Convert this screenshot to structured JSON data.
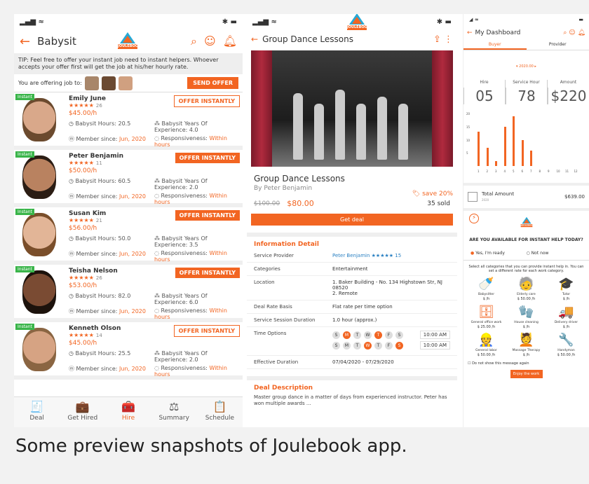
{
  "caption": "Some preview snapshots of Joulebook app.",
  "logo_text": "JOULEBOOK",
  "p1": {
    "title": "Babysit",
    "tip": "TIP: Feel free to offer your instant job need to instant helpers. Whoever accepts your offer first will get the job at his/her hourly rate.",
    "offering_label": "You are offering job to:",
    "send_offer": "SEND OFFER",
    "badge": "Instant",
    "hours_label": "Babysit Hours:",
    "years_label": "Babysit Years Of Experience:",
    "member_label": "Member since:",
    "resp_label": "Responsiveness:",
    "helpers": [
      {
        "name": "Emily June",
        "stars": "★★★★★",
        "count": "26",
        "rate": "$45.00/h",
        "hours": "20.5",
        "years": "4.0",
        "since": "Jun, 2020",
        "resp": "Within hours",
        "offer": "OFFER INSTANTLY",
        "filled": false,
        "skin": "#d9a88a",
        "hair": "#6b4a2e"
      },
      {
        "name": "Peter Benjamin",
        "stars": "★★★★★",
        "count": "11",
        "rate": "$50.00/h",
        "hours": "60.5",
        "years": "2.0",
        "since": "Jun, 2020",
        "resp": "Within hours",
        "offer": "OFFER INSTANTLY",
        "filled": true,
        "skin": "#b98260",
        "hair": "#2b1d14"
      },
      {
        "name": "Susan Kim",
        "stars": "★★★★★",
        "count": "21",
        "rate": "$56.00/h",
        "hours": "50.0",
        "years": "3.5",
        "since": "Jun, 2020",
        "resp": "Within hours",
        "offer": "OFFER INSTANTLY",
        "filled": true,
        "skin": "#e2b597",
        "hair": "#7a4e2a"
      },
      {
        "name": "Teisha Nelson",
        "stars": "★★★★★",
        "count": "26",
        "rate": "$53.00/h",
        "hours": "82.0",
        "years": "6.0",
        "since": "Jun, 2020",
        "resp": "Within hours",
        "offer": "OFFER INSTANTLY",
        "filled": true,
        "skin": "#7a4b33",
        "hair": "#1c120c"
      },
      {
        "name": "Kenneth Olson",
        "stars": "★★★★★",
        "count": "14",
        "rate": "$45.00/h",
        "hours": "25.5",
        "years": "2.0",
        "since": "Jun, 2020",
        "resp": "Within hours",
        "offer": "OFFER INSTANTLY",
        "filled": false,
        "skin": "#d6a383",
        "hair": "#8a6542"
      }
    ],
    "nav": [
      {
        "label": "Deal",
        "icon": "🧾"
      },
      {
        "label": "Get Hired",
        "icon": "💼"
      },
      {
        "label": "Hire",
        "icon": "🧰",
        "active": true
      },
      {
        "label": "Summary",
        "icon": "⚖"
      },
      {
        "label": "Schedule",
        "icon": "📋"
      }
    ]
  },
  "p2": {
    "title": "Group Dance Lessons",
    "product": "Group Dance Lessons",
    "save": "save 20%",
    "by": "By Peter Benjamin",
    "old_price": "$100.00",
    "price": "$80.00",
    "sold": "35 sold",
    "get_deal": "Get deal",
    "info_title": "Information Detail",
    "rows": [
      {
        "k": "Service Provider",
        "v": "Peter Benjamin ★★★★★ 15"
      },
      {
        "k": "Categories",
        "v": "Entertainment"
      },
      {
        "k": "Location",
        "v": "1. Baker Building - No. 134 Highstown Str, NJ 08520\n2. Remote"
      },
      {
        "k": "Deal Rate Basis",
        "v": "Flat rate per time option"
      },
      {
        "k": "Service Session Duration",
        "v": "1.0 hour (approx.)"
      }
    ],
    "time_label": "Time Options",
    "week1": [
      "S",
      "M",
      "T",
      "W",
      "T",
      "F",
      "S"
    ],
    "week1_on": [
      1,
      4
    ],
    "week2_on": [
      3,
      6
    ],
    "time": "10:00 AM",
    "eff_label": "Effective Duration",
    "eff": "07/04/2020  -  07/29/2020",
    "desc_title": "Deal Description",
    "desc": "Master group dance in a matter of days from experienced instructor. Peter has won multiple awards ..."
  },
  "p3": {
    "title": "My Dashboard",
    "tab_buyer": "Buyer",
    "tab_provider": "Provider",
    "year": "2020.00",
    "hire_label": "Hire",
    "hire": "05",
    "hour_label": "Service Hour",
    "hour": "78",
    "amount_label": "Amount",
    "amount": "$220",
    "chart_data": {
      "type": "bar",
      "categories": [
        "1",
        "2",
        "3",
        "4",
        "5",
        "6",
        "7",
        "8",
        "9",
        "10",
        "11",
        "12"
      ],
      "values": [
        13,
        7,
        2,
        15,
        19,
        10,
        6,
        0,
        0,
        0,
        0,
        0
      ],
      "ylim": [
        0,
        20
      ],
      "yticks": [
        "20",
        "15",
        "10",
        "5"
      ]
    },
    "total_label": "Total Amount",
    "total_year": "2020",
    "total": "$639.00",
    "avail_q": "ARE YOU AVAILABLE FOR INSTANT HELP TODAY?",
    "yes": "Yes, I'm ready",
    "no": "Not now",
    "select_info": "Select all categories that you can provide instant help in. You can set a different rate for each work category.",
    "cats": [
      {
        "n": "Babysitter",
        "r": "$     /h",
        "i": "🍼"
      },
      {
        "n": "Elderly care",
        "r": "$ 50.00 /h",
        "i": "🧓"
      },
      {
        "n": "Tutor",
        "r": "$     /h",
        "i": "🎓"
      },
      {
        "n": "General office work",
        "r": "$ 25.00 /h",
        "i": "🗄"
      },
      {
        "n": "House cleaning",
        "r": "$     /h",
        "i": "🧤"
      },
      {
        "n": "Delivery driver",
        "r": "$     /h",
        "i": "🚚"
      },
      {
        "n": "General labor",
        "r": "$ 50.00 /h",
        "i": "👷"
      },
      {
        "n": "Massage Therapy",
        "r": "$     /h",
        "i": "💆"
      },
      {
        "n": "Handyman",
        "r": "$ 50.00 /h",
        "i": "🔧"
      }
    ],
    "no_show": "Do not show this message again",
    "enjoy": "Enjoy the work"
  }
}
